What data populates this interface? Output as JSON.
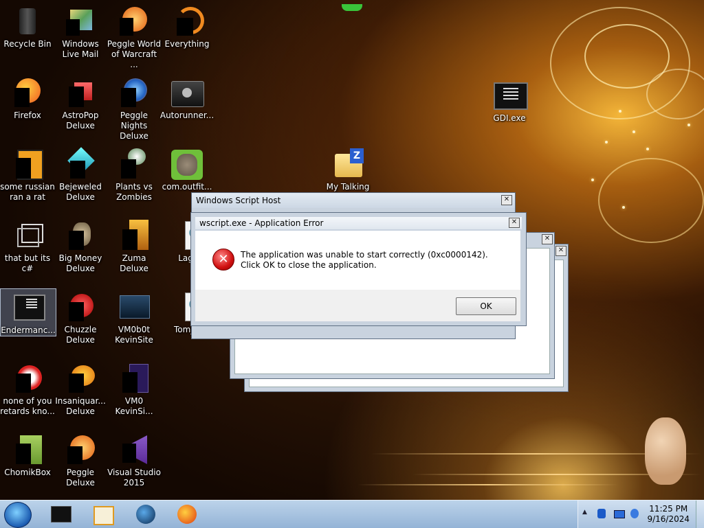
{
  "desktop": {
    "icons": [
      {
        "label": "Recycle Bin",
        "icon": "recycle-bin-icon"
      },
      {
        "label": "Windows Live Mail",
        "icon": "windows-live-mail-icon"
      },
      {
        "label": "Peggle World of Warcraft ...",
        "icon": "peggle-wow-icon"
      },
      {
        "label": "Everything",
        "icon": "everything-icon"
      },
      {
        "label": "Firefox",
        "icon": "firefox-icon"
      },
      {
        "label": "AstroPop Deluxe",
        "icon": "astropop-icon"
      },
      {
        "label": "Peggle Nights Deluxe",
        "icon": "peggle-nights-icon"
      },
      {
        "label": "Autorunner...",
        "icon": "autorunner-icon"
      },
      {
        "label": "GDI.exe",
        "icon": "gdi-exe-icon"
      },
      {
        "label": "some russian ran a rat",
        "icon": "app-icon"
      },
      {
        "label": "Bejeweled Deluxe",
        "icon": "bejeweled-icon"
      },
      {
        "label": "Plants vs Zombies",
        "icon": "plants-vs-zombies-icon"
      },
      {
        "label": "com.outfit...",
        "icon": "talking-tom-icon"
      },
      {
        "label": "My Talking",
        "icon": "zip-folder-icon"
      },
      {
        "label": "that but its c#",
        "icon": "shortcut-icon"
      },
      {
        "label": "Big Money Deluxe",
        "icon": "big-money-icon"
      },
      {
        "label": "Zuma Deluxe",
        "icon": "zuma-icon"
      },
      {
        "label": "Lag.",
        "icon": "script-file-icon"
      },
      {
        "label": "Endermanc...",
        "icon": "endermanch-icon"
      },
      {
        "label": "Chuzzle Deluxe",
        "icon": "chuzzle-icon"
      },
      {
        "label": "VM0b0t KevinSite",
        "icon": "vm-icon"
      },
      {
        "label": "Tom_1",
        "icon": "script-file-icon"
      },
      {
        "label": "none of you retards kno...",
        "icon": "app-icon"
      },
      {
        "label": "Insaniquar... Deluxe",
        "icon": "insaniquarium-icon"
      },
      {
        "label": "VM0 KevinSi...",
        "icon": "vm-file-icon"
      },
      {
        "label": "ChomikBox",
        "icon": "chomikbox-icon"
      },
      {
        "label": "Peggle Deluxe",
        "icon": "peggle-icon"
      },
      {
        "label": "Visual Studio 2015",
        "icon": "visual-studio-icon"
      }
    ]
  },
  "dialogs": {
    "wsh_title": "Windows Script Host",
    "error": {
      "title": "wscript.exe - Application Error",
      "message": "The application was unable to start correctly (0xc0000142). Click OK to close the application.",
      "ok_label": "OK"
    },
    "close_glyph": "✕"
  },
  "taskbar": {
    "time": "11:25 PM",
    "date": "9/16/2024",
    "show_desktop_glyph": "▲"
  }
}
